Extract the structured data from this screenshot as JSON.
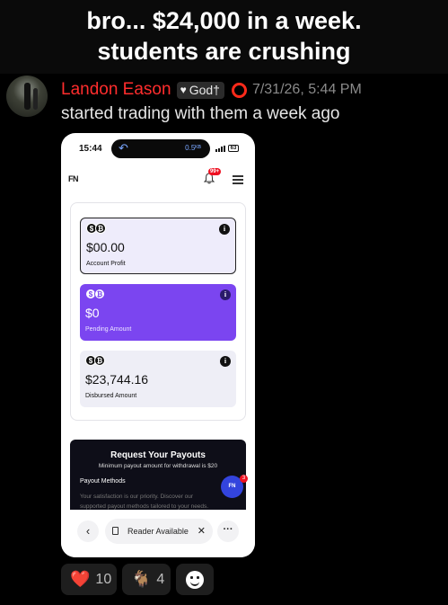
{
  "caption": {
    "line1": "bro... $24,000 in a week.",
    "line2": "students are crushing"
  },
  "post": {
    "username": "Landon Eason",
    "badge": "God†",
    "timestamp": "7/31/26, 5:44 PM",
    "message": "started trading with them a week ago",
    "username_color": "#ff2d2d"
  },
  "phone": {
    "status_time": "15:44",
    "speed": "0.5ᴷᴮ",
    "battery": "63",
    "logo": "FN",
    "notification_count": "99+",
    "cards": [
      {
        "amount": "$00.00",
        "label": "Account Profit",
        "coins": [
          "$",
          "₿"
        ]
      },
      {
        "amount": "$0",
        "label": "Pending Amount",
        "coins": [
          "$",
          "₿"
        ]
      },
      {
        "amount": "$23,744.16",
        "label": "Disbursed Amount",
        "coins": [
          "$",
          "₿"
        ]
      }
    ],
    "payout": {
      "title": "Request Your Payouts",
      "subtitle": "Minimum payout amount for withdrawal is $20",
      "methods_label": "Payout Methods",
      "description": "Your satisfaction is our priority. Discover our supported payout methods tailored to your needs."
    },
    "chat_badge": "3",
    "chat_logo": "FN",
    "toolbar": {
      "reader_label": "Reader Available",
      "back": "‹",
      "close": "✕",
      "more": "···"
    },
    "accent_color": "#7b45f0"
  },
  "reactions": [
    {
      "emoji": "❤️",
      "count": "10"
    },
    {
      "emoji": "🐐",
      "count": "4"
    }
  ]
}
